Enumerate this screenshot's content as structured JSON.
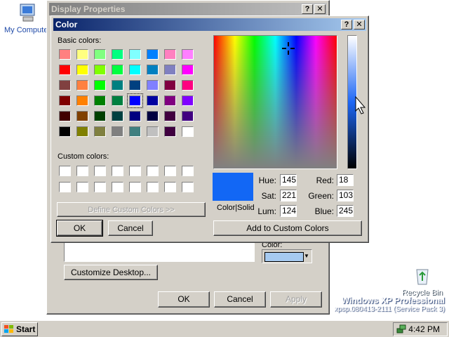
{
  "desktop": {
    "my_computer": "My Computer",
    "recycle_bin": "Recycle Bin",
    "watermark_line1": "Windows XP Professional",
    "watermark_line2": "xpsp.080413-2111 (Service Pack 3)"
  },
  "display_properties": {
    "title": "Display Properties",
    "color_label": "Color:",
    "customize_button": "Customize Desktop...",
    "ok": "OK",
    "cancel": "Cancel",
    "apply": "Apply"
  },
  "color_dialog": {
    "title": "Color",
    "basic_colors_label": "Basic colors:",
    "custom_colors_label": "Custom colors:",
    "define_custom_button": "Define Custom Colors >>",
    "ok": "OK",
    "cancel": "Cancel",
    "add_custom_button": "Add to Custom Colors",
    "color_solid_label": "Color|Solid",
    "hue_label": "Hue:",
    "sat_label": "Sat:",
    "lum_label": "Lum:",
    "red_label": "Red:",
    "green_label": "Green:",
    "blue_label": "Blue:",
    "hue": "145",
    "sat": "221",
    "lum": "124",
    "red": "18",
    "green": "103",
    "blue": "245",
    "selected_color": "#1267f5",
    "basic_colors": [
      [
        "#ff8080",
        "#ffff80",
        "#80ff80",
        "#00ff80",
        "#80ffff",
        "#0080ff",
        "#ff80c0",
        "#ff80ff"
      ],
      [
        "#ff0000",
        "#ffff00",
        "#80ff00",
        "#00ff40",
        "#00ffff",
        "#0080c0",
        "#8080c0",
        "#ff00ff"
      ],
      [
        "#804040",
        "#ff8040",
        "#00ff00",
        "#008080",
        "#004080",
        "#8080ff",
        "#800040",
        "#ff0080"
      ],
      [
        "#800000",
        "#ff8000",
        "#008000",
        "#008040",
        "#0000ff",
        "#0000a0",
        "#800080",
        "#8000ff"
      ],
      [
        "#400000",
        "#804000",
        "#004000",
        "#004040",
        "#000080",
        "#000040",
        "#400040",
        "#400080"
      ],
      [
        "#000000",
        "#808000",
        "#808040",
        "#808080",
        "#408080",
        "#c0c0c0",
        "#400040",
        "#ffffff"
      ]
    ],
    "selected_basic_index": [
      3,
      4
    ]
  },
  "taskbar": {
    "start": "Start",
    "clock": "4:42 PM"
  }
}
